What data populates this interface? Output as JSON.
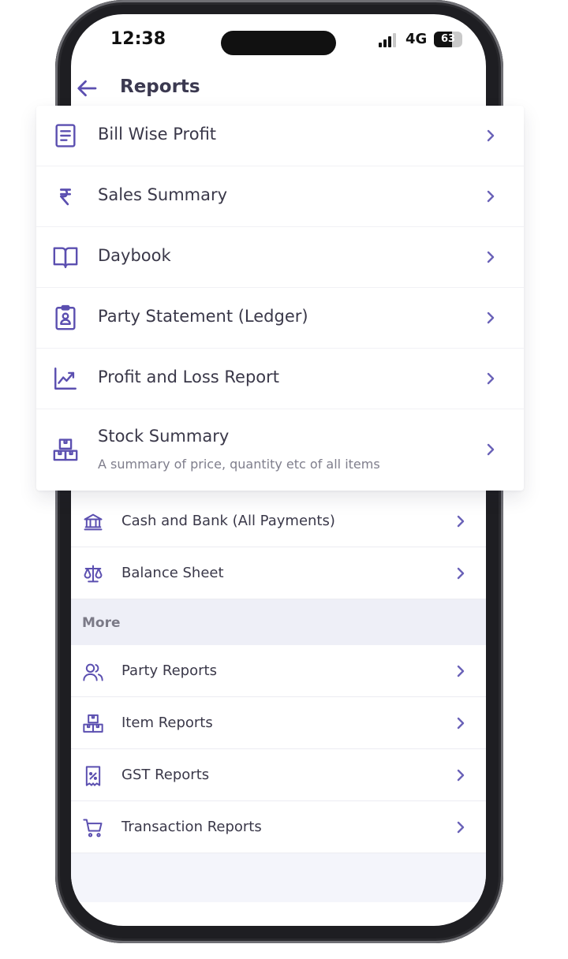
{
  "status_bar": {
    "time": "12:38",
    "network": "4G",
    "battery": "63",
    "battery_level": 0.63
  },
  "header": {
    "title": "Reports"
  },
  "featured": [
    {
      "label": "Bill Wise Profit",
      "icon": "document-icon"
    },
    {
      "label": "Sales Summary",
      "icon": "rupee-icon"
    },
    {
      "label": "Daybook",
      "icon": "book-icon"
    },
    {
      "label": "Party Statement (Ledger)",
      "icon": "clipboard-user-icon"
    },
    {
      "label": "Profit and Loss Report",
      "icon": "trend-up-icon"
    },
    {
      "label": "Stock Summary",
      "subtitle": "A summary of price, quantity etc of all items",
      "icon": "boxes-icon"
    }
  ],
  "list": [
    {
      "label": "Cash and Bank (All Payments)",
      "icon": "bank-icon"
    },
    {
      "label": "Balance Sheet",
      "icon": "scale-icon"
    }
  ],
  "more": {
    "title": "More",
    "items": [
      {
        "label": "Party Reports",
        "icon": "users-icon"
      },
      {
        "label": "Item Reports",
        "icon": "boxes-icon"
      },
      {
        "label": "GST Reports",
        "icon": "percent-receipt-icon"
      },
      {
        "label": "Transaction Reports",
        "icon": "cart-icon"
      }
    ]
  },
  "colors": {
    "accent": "#5b4fb0",
    "chevron": "#6a62b8",
    "section_bg": "#eeeff7"
  }
}
